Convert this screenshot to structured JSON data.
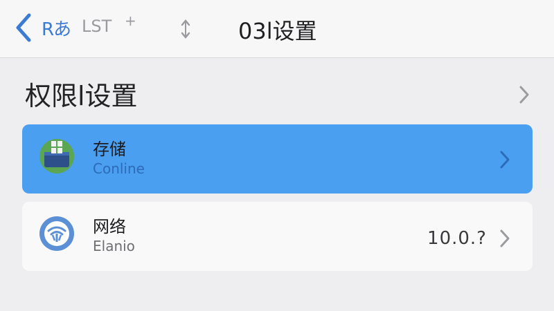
{
  "nav": {
    "back_label": "Rあ",
    "secondary_label": "LST",
    "plus_glyph": "+",
    "title": "03l设置"
  },
  "section": {
    "title": "权限l设置"
  },
  "rows": [
    {
      "title": "存储",
      "subtitle": "Conline",
      "value": "",
      "icon": "storage-drive-icon",
      "selected": true
    },
    {
      "title": "网络",
      "subtitle": "Elanio",
      "value": "10.0.?",
      "icon": "wifi-icon",
      "selected": false
    }
  ],
  "colors": {
    "accent": "#3a7bd5",
    "selected_row": "#4b9ff0",
    "background": "#eeeef0"
  }
}
